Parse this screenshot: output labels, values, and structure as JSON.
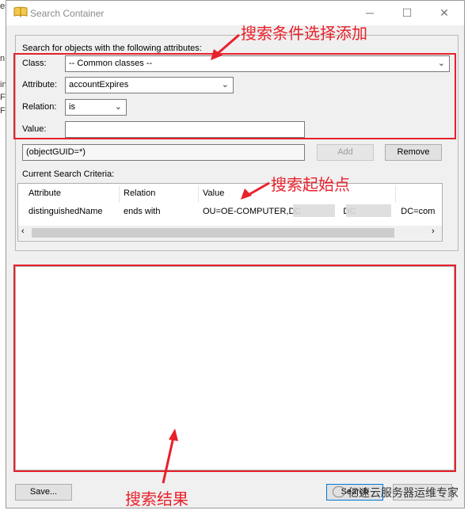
{
  "background": {
    "lines": [
      "es",
      "n",
      "in",
      "Fir",
      "Fir"
    ]
  },
  "window": {
    "title": "Search Container",
    "controls": {
      "minimize": "─",
      "maximize": "☐",
      "close": "✕"
    }
  },
  "form": {
    "heading": "Search for objects with the following attributes:",
    "class_label": "Class:",
    "class_value": "-- Common classes --",
    "attribute_label": "Attribute:",
    "attribute_value": "accountExpires",
    "relation_label": "Relation:",
    "relation_value": "is",
    "value_label": "Value:",
    "value_input": "",
    "filter_value": "(objectGUID=*)",
    "add_label": "Add",
    "remove_label": "Remove"
  },
  "criteria": {
    "label": "Current Search Criteria:",
    "columns": [
      "Attribute",
      "Relation",
      "Value"
    ],
    "rows": [
      {
        "attribute": "distinguishedName",
        "relation": "ends with",
        "value_start": "OU=OE-COMPUTER,DC",
        "value_mid": "DC",
        "value_end": "DC=com"
      }
    ]
  },
  "footer": {
    "save_label": "Save...",
    "search_label": "Search"
  },
  "annotations": {
    "conditions": "搜索条件选择添加",
    "start_point": "搜索起始点",
    "results": "搜索结果"
  },
  "watermark": "亿速云服务器运维专家",
  "colors": {
    "annotation_red": "#e8212b",
    "window_bg": "#f0f0f0"
  }
}
